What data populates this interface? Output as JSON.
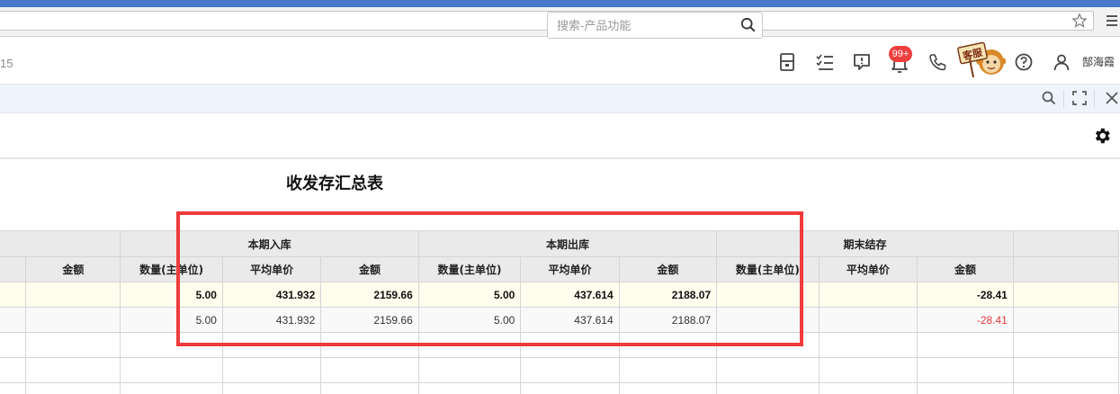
{
  "header": {
    "left_fragment": "15",
    "search": {
      "placeholder": "搜索-产品功能",
      "value": ""
    },
    "notification_count": "99+",
    "service_label": "客服",
    "user_name": "郜海霞"
  },
  "report": {
    "title": "收发存汇总表",
    "group_headers": [
      "本期入库",
      "本期出库",
      "期末结存"
    ],
    "column_headers": [
      "金额",
      "数量(主单位)",
      "平均单价",
      "金额",
      "数量(主单位)",
      "平均单价",
      "金额",
      "数量(主单位)",
      "平均单价",
      "金额"
    ],
    "rows": [
      {
        "type": "summary",
        "cells": [
          "",
          "5.00",
          "431.932",
          "2159.66",
          "5.00",
          "437.614",
          "2188.07",
          "",
          "",
          "-28.41"
        ]
      },
      {
        "type": "data",
        "cells": [
          "",
          "5.00",
          "431.932",
          "2159.66",
          "5.00",
          "437.614",
          "2188.07",
          "",
          "",
          "-28.41"
        ]
      },
      {
        "type": "empty",
        "cells": [
          "",
          "",
          "",
          "",
          "",
          "",
          "",
          "",
          "",
          ""
        ]
      },
      {
        "type": "empty",
        "cells": [
          "",
          "",
          "",
          "",
          "",
          "",
          "",
          "",
          "",
          ""
        ]
      },
      {
        "type": "empty",
        "cells": [
          "",
          "",
          "",
          "",
          "",
          "",
          "",
          "",
          "",
          ""
        ]
      }
    ]
  },
  "colors": {
    "browser_top": "#4778c9",
    "negative": "#e53a3a",
    "highlight": "#ee3b3b",
    "badge": "#ef3e3e"
  },
  "icons": {
    "header": [
      "search-icon",
      "calculator-icon",
      "task-list-icon",
      "message-icon",
      "bell-icon",
      "phone-icon",
      "customer-service-icon",
      "help-icon",
      "user-icon"
    ],
    "toolbar": [
      "search-icon",
      "fullscreen-icon",
      "close-icon"
    ],
    "settings": "gear-icon"
  }
}
